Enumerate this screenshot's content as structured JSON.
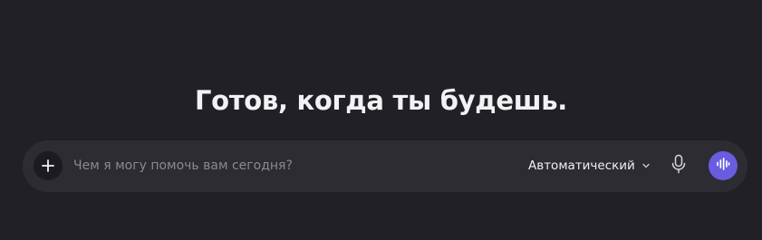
{
  "main": {
    "headline": "Готов, когда ты будешь."
  },
  "composer": {
    "input_placeholder": "Чем я могу помочь вам сегодня?",
    "input_value": "",
    "mode_label": "Автоматический",
    "icons": {
      "add": "plus-icon",
      "mode_dropdown": "chevron-down-icon",
      "mic": "microphone-icon",
      "voice": "voice-waveform-icon"
    }
  },
  "colors": {
    "background": "#212026",
    "composer_background": "#2d2c32",
    "add_button_background": "#1c1b20",
    "accent": "#6a5ce0",
    "text_primary": "#f2f2f4",
    "placeholder": "#8a898f"
  }
}
